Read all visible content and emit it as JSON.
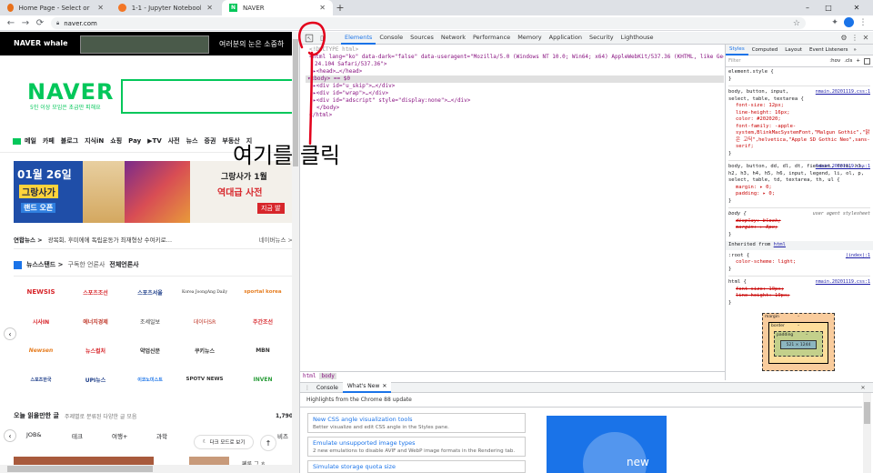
{
  "browser": {
    "tabs": [
      {
        "label": "Home Page - Select or create a",
        "favicon_color": "#e8711c"
      },
      {
        "label": "1-1 - Jupyter Notebook",
        "favicon_color": "#f37626"
      },
      {
        "label": "NAVER",
        "favicon_color": "#03c75a"
      }
    ],
    "address": "naver.com",
    "new_tab": "+",
    "window_controls": {
      "minimize": "–",
      "maximize": "□",
      "close": "✕"
    }
  },
  "naver": {
    "whale_brand": "NAVER whale",
    "whale_banner_text": "여러분의 눈은 소중하",
    "logo": "NAVER",
    "tagline": "5인 이상 모임은 초급만 피해요",
    "menu": [
      "메일",
      "카페",
      "블로그",
      "지식iN",
      "쇼핑",
      "Pay",
      "▶TV",
      "사전",
      "뉴스",
      "증권",
      "부동산",
      "지"
    ],
    "banner_date": "01월 26일",
    "banner_title": "그랑사가",
    "banner_sub": "랜드 오픈",
    "banner2_line1": "그랑사가 1월",
    "banner2_line2": "역대급 사전",
    "banner2_line3": "지금 발",
    "news_ticker_source": "연합뉴스 >",
    "news_ticker_text": "광복회, 후미에에 독립운동가 최재형상 수여키로…",
    "news_ticker_more": "네이버뉴스 >",
    "newsstand_title": "뉴스스탠드 >",
    "newsstand_sub": "구독한 언론사",
    "newsstand_all": "전체언론사",
    "news_logos": [
      [
        "NEWSIS",
        "스포츠조선",
        "스포츠서울",
        "Korea JoongAng Daily",
        "sportal korea"
      ],
      [
        "시사IN",
        "에너지경제",
        "조세일보",
        "데이터SR",
        "주간조선"
      ],
      [
        "Newsen",
        "뉴스컬처",
        "약업신문",
        "쿠키뉴스",
        "MBN"
      ],
      [
        "스포츠한국",
        "UPI뉴스",
        "이코노미스트",
        "SPOTV NEWS",
        "INVEN"
      ]
    ],
    "reading_title": "오늘 읽을만한 글",
    "reading_sub": "주제별로 분류된 다양한 글 모음",
    "reading_count": "1,790",
    "categories": [
      "JOB&",
      "테크",
      "여행+",
      "과학"
    ],
    "categories_right": "비즈",
    "dark_mode_label": "다크 모드로 보기",
    "to_top": "↑",
    "bottom_right_snippet": "페루 그 ㅎ"
  },
  "annotation": {
    "text": "여기를 클릭"
  },
  "devtools": {
    "tabs": [
      "Elements",
      "Console",
      "Sources",
      "Network",
      "Performance",
      "Memory",
      "Application",
      "Security",
      "Lighthouse"
    ],
    "active_tab": "Elements",
    "html_lines": [
      "<!DOCTYPE html>",
      "<html lang=\"ko\" data-dark=\"false\" data-useragent=\"Mozilla/5.0 (Windows NT 10.0; Win64; x64) AppleWebKit/537.36 (KHTML, like Gecko) Chrome/8",
      "24.104 Safari/537.36\">",
      "▸<head>…</head>",
      "▾<body> == $0",
      "▸<div id=\"u_skip\">…</div>",
      "▸<div id=\"wrap\">…</div>",
      "▸<div id=\"adscript\" style=\"display:none\">…</div>",
      "</body>",
      "</html>"
    ],
    "breadcrumb": [
      "html",
      "body"
    ],
    "styles_tabs": [
      "Styles",
      "Computed",
      "Layout",
      "Event Listeners",
      "»"
    ],
    "filter_placeholder": "Filter",
    "filter_buttons": [
      ":hov",
      ".cls",
      "+"
    ],
    "style_blocks": [
      {
        "selector": "element.style {",
        "source": "",
        "props": [],
        "close": "}"
      },
      {
        "selector": "body, button, input, select, table, textarea {",
        "source": "nmain.20201119.css:1",
        "props": [
          "font-size: 12px;",
          "line-height: 16px;",
          "color: #202020;",
          "font-family: -apple-system,BlinkMacSystemFont,\"Malgun Gothic\",\"맑은 고딕\",helvetica,\"Apple SD Gothic Neo\",sans-serif;"
        ],
        "close": "}"
      },
      {
        "selector": "body, button, dd, dl, dt, fieldset, form, h1, h2, h3, h4, h5, h6, input, legend, li, ol, p, select, table, td, textarea, th, ul {",
        "source": "nmain.20201119.css:1",
        "props": [
          "margin: ▸ 0;",
          "padding: ▸ 0;"
        ],
        "close": "}"
      },
      {
        "selector": "body {",
        "source": "user agent stylesheet",
        "props": [
          "display: block;",
          "margin: ▸ 8px;"
        ],
        "close": "}"
      }
    ],
    "inherited_label": "Inherited from",
    "inherited_tag": "html",
    "root_block": {
      "selector": ":root {",
      "source": "(index):1",
      "prop": "color-scheme: light;"
    },
    "html_block": {
      "selector": "html {",
      "source": "nmain.20201119.css:1",
      "props": [
        "font-size: 10px;",
        "line-height: 10px;"
      ]
    },
    "box_model": {
      "margin": "margin",
      "border": "border",
      "padding": "padding",
      "content": "521 × 1244",
      "dash": "–"
    },
    "drawer_tabs": [
      "Console",
      "What's New"
    ],
    "whats_new_header": "Highlights from the Chrome 88 update",
    "whats_new_items": [
      {
        "title": "New CSS angle visualization tools",
        "desc": "Better visualize and edit CSS angle in the Styles pane."
      },
      {
        "title": "Emulate unsupported image types",
        "desc": "2 new emulations to disable AVIF and WebP image formats in the Rendering tab."
      },
      {
        "title": "Simulate storage quota size",
        "desc": ""
      }
    ],
    "promo_text": "new"
  },
  "colors": {
    "naver_green": "#03c75a",
    "devtools_blue": "#1a73e8",
    "annotation_red": "#e3001b"
  }
}
